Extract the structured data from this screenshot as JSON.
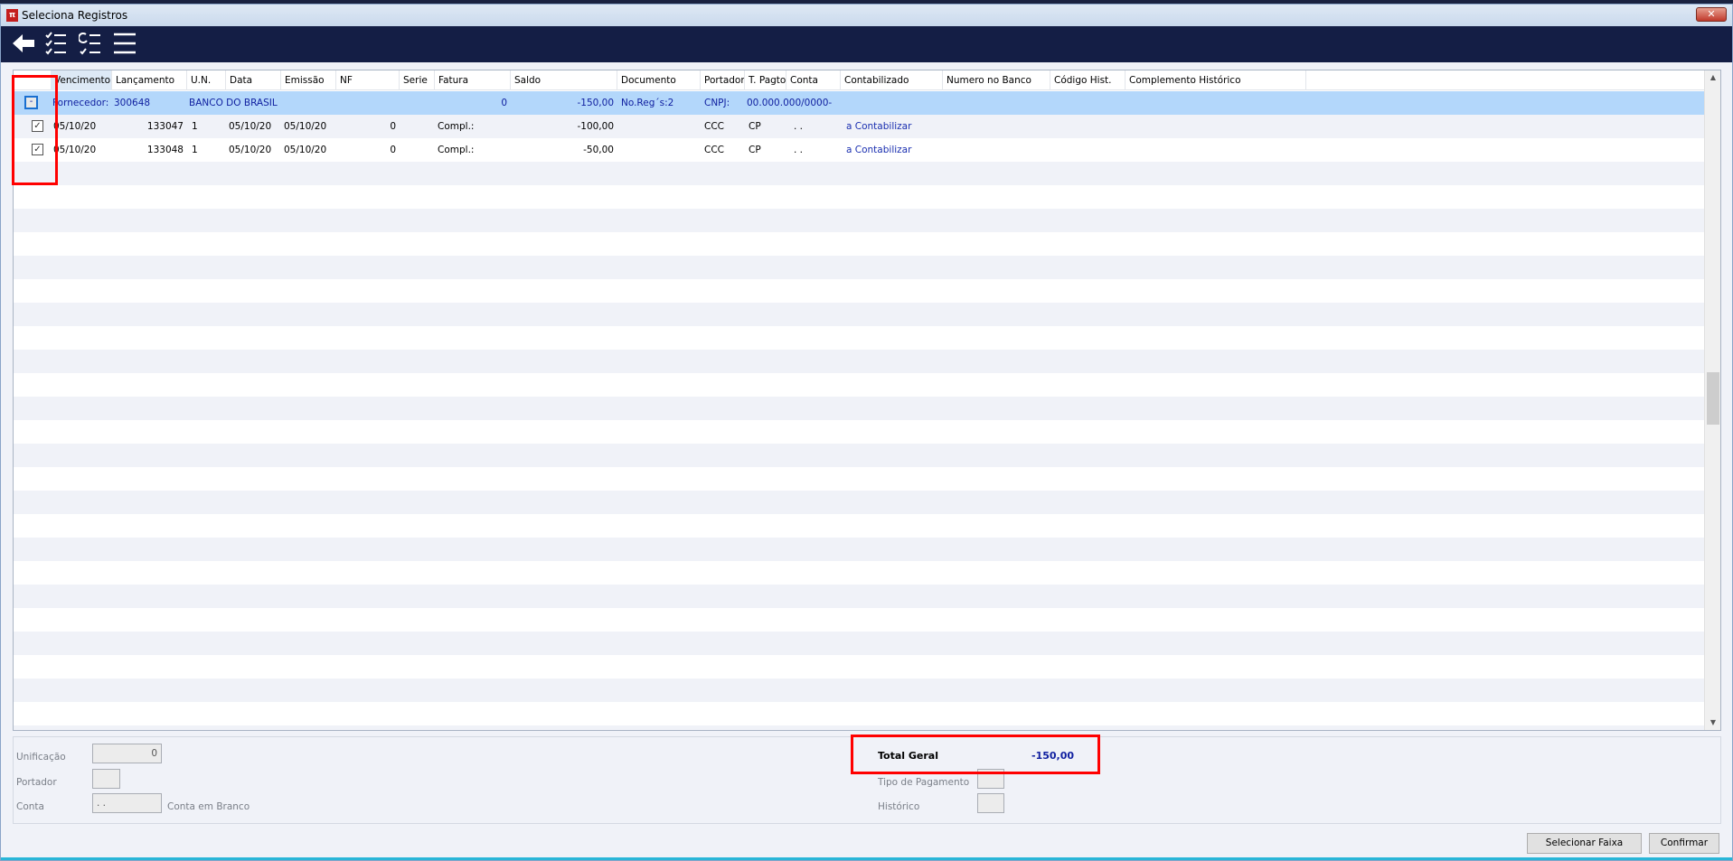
{
  "window": {
    "title": "Seleciona Registros",
    "close_label": "✕"
  },
  "toolbar": [
    "back-icon",
    "check-list-icon",
    "refresh-list-icon",
    "menu-icon"
  ],
  "grid": {
    "columns": [
      "Vencimento",
      "Lançamento",
      "U.N.",
      "Data",
      "Emissão",
      "NF",
      "Serie",
      "Fatura",
      "Saldo",
      "Documento",
      "Portador",
      "T. Pagto",
      "Conta",
      "Contabilizado",
      "Numero no Banco",
      "Código Hist.",
      "Complemento Histórico"
    ],
    "group": {
      "expander": "-",
      "label": "Fornecedor:",
      "code": "300648",
      "name": "BANCO DO BRASIL",
      "fatura": "0",
      "saldo": "-150,00",
      "documento": "No.Reg´s:2",
      "portador": "CNPJ:",
      "cnpj": "00.000.000/0000-"
    },
    "rows": [
      {
        "checked": true,
        "check": "✓",
        "vencimento": "05/10/20",
        "lancamento": "133047",
        "un": "1",
        "data": "05/10/20",
        "emissao": "05/10/20",
        "nf": "0",
        "fatura": "Compl.:",
        "saldo": "-100,00",
        "portador": "CCC",
        "tpagto": "CP",
        "conta": ". .",
        "contabilizado": "a Contabilizar"
      },
      {
        "checked": true,
        "check": "✓",
        "vencimento": "05/10/20",
        "lancamento": "133048",
        "un": "1",
        "data": "05/10/20",
        "emissao": "05/10/20",
        "nf": "0",
        "fatura": "Compl.:",
        "saldo": "-50,00",
        "portador": "CCC",
        "tpagto": "CP",
        "conta": ". .",
        "contabilizado": "a Contabilizar"
      }
    ]
  },
  "footer": {
    "unificacao_label": "Unificação",
    "unificacao_value": "0",
    "portador_label": "Portador",
    "portador_value": "",
    "conta_label": "Conta",
    "conta_value": ". .",
    "conta_em_branco": "Conta em Branco",
    "total_label": "Total Geral",
    "total_value": "-150,00",
    "tipo_pagamento_label": "Tipo de Pagamento",
    "historico_label": "Histórico",
    "selecionar_faixa": "Selecionar Faixa",
    "confirmar": "Confirmar"
  },
  "colors": {
    "accent": "#141e45",
    "selected_row": "#b3d7fb",
    "highlight": "#ff0000"
  }
}
